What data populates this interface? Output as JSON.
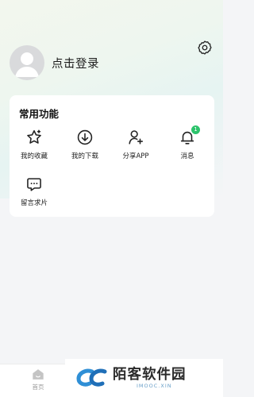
{
  "profile": {
    "login_text": "点击登录"
  },
  "functions": {
    "title": "常用功能",
    "items": [
      {
        "label": "我的收藏",
        "icon": "star-icon"
      },
      {
        "label": "我的下载",
        "icon": "download-icon"
      },
      {
        "label": "分享APP",
        "icon": "add-user-icon"
      },
      {
        "label": "消息",
        "icon": "bell-icon",
        "badge": "1"
      },
      {
        "label": "留言求片",
        "icon": "comment-icon"
      }
    ]
  },
  "tabbar": {
    "home_label": "首页"
  },
  "watermark": {
    "cn": "陌客软件园",
    "en": "IMOOC.XIN"
  },
  "colors": {
    "accent": "#2cc36b",
    "card": "#ffffff",
    "background": "#f4f5f7"
  }
}
